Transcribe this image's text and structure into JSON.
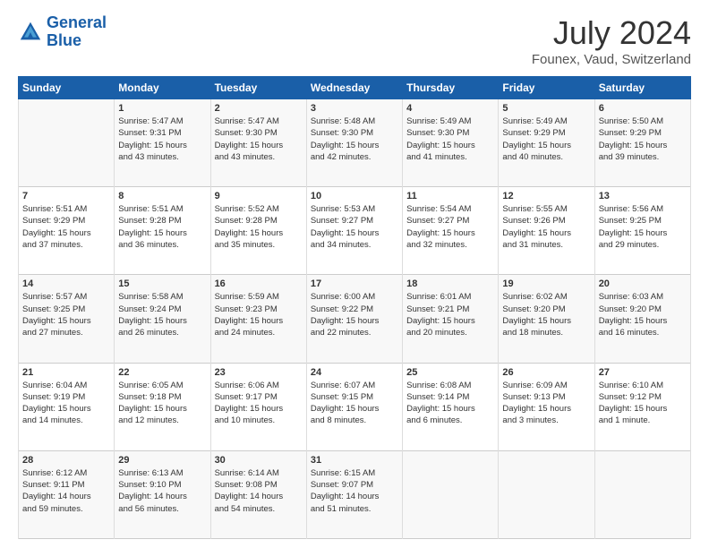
{
  "header": {
    "logo": {
      "line1": "General",
      "line2": "Blue"
    },
    "title": "July 2024",
    "location": "Founex, Vaud, Switzerland"
  },
  "weekdays": [
    "Sunday",
    "Monday",
    "Tuesday",
    "Wednesday",
    "Thursday",
    "Friday",
    "Saturday"
  ],
  "weeks": [
    [
      {
        "day": "",
        "content": ""
      },
      {
        "day": "1",
        "content": "Sunrise: 5:47 AM\nSunset: 9:31 PM\nDaylight: 15 hours\nand 43 minutes."
      },
      {
        "day": "2",
        "content": "Sunrise: 5:47 AM\nSunset: 9:30 PM\nDaylight: 15 hours\nand 43 minutes."
      },
      {
        "day": "3",
        "content": "Sunrise: 5:48 AM\nSunset: 9:30 PM\nDaylight: 15 hours\nand 42 minutes."
      },
      {
        "day": "4",
        "content": "Sunrise: 5:49 AM\nSunset: 9:30 PM\nDaylight: 15 hours\nand 41 minutes."
      },
      {
        "day": "5",
        "content": "Sunrise: 5:49 AM\nSunset: 9:29 PM\nDaylight: 15 hours\nand 40 minutes."
      },
      {
        "day": "6",
        "content": "Sunrise: 5:50 AM\nSunset: 9:29 PM\nDaylight: 15 hours\nand 39 minutes."
      }
    ],
    [
      {
        "day": "7",
        "content": "Sunrise: 5:51 AM\nSunset: 9:29 PM\nDaylight: 15 hours\nand 37 minutes."
      },
      {
        "day": "8",
        "content": "Sunrise: 5:51 AM\nSunset: 9:28 PM\nDaylight: 15 hours\nand 36 minutes."
      },
      {
        "day": "9",
        "content": "Sunrise: 5:52 AM\nSunset: 9:28 PM\nDaylight: 15 hours\nand 35 minutes."
      },
      {
        "day": "10",
        "content": "Sunrise: 5:53 AM\nSunset: 9:27 PM\nDaylight: 15 hours\nand 34 minutes."
      },
      {
        "day": "11",
        "content": "Sunrise: 5:54 AM\nSunset: 9:27 PM\nDaylight: 15 hours\nand 32 minutes."
      },
      {
        "day": "12",
        "content": "Sunrise: 5:55 AM\nSunset: 9:26 PM\nDaylight: 15 hours\nand 31 minutes."
      },
      {
        "day": "13",
        "content": "Sunrise: 5:56 AM\nSunset: 9:25 PM\nDaylight: 15 hours\nand 29 minutes."
      }
    ],
    [
      {
        "day": "14",
        "content": "Sunrise: 5:57 AM\nSunset: 9:25 PM\nDaylight: 15 hours\nand 27 minutes."
      },
      {
        "day": "15",
        "content": "Sunrise: 5:58 AM\nSunset: 9:24 PM\nDaylight: 15 hours\nand 26 minutes."
      },
      {
        "day": "16",
        "content": "Sunrise: 5:59 AM\nSunset: 9:23 PM\nDaylight: 15 hours\nand 24 minutes."
      },
      {
        "day": "17",
        "content": "Sunrise: 6:00 AM\nSunset: 9:22 PM\nDaylight: 15 hours\nand 22 minutes."
      },
      {
        "day": "18",
        "content": "Sunrise: 6:01 AM\nSunset: 9:21 PM\nDaylight: 15 hours\nand 20 minutes."
      },
      {
        "day": "19",
        "content": "Sunrise: 6:02 AM\nSunset: 9:20 PM\nDaylight: 15 hours\nand 18 minutes."
      },
      {
        "day": "20",
        "content": "Sunrise: 6:03 AM\nSunset: 9:20 PM\nDaylight: 15 hours\nand 16 minutes."
      }
    ],
    [
      {
        "day": "21",
        "content": "Sunrise: 6:04 AM\nSunset: 9:19 PM\nDaylight: 15 hours\nand 14 minutes."
      },
      {
        "day": "22",
        "content": "Sunrise: 6:05 AM\nSunset: 9:18 PM\nDaylight: 15 hours\nand 12 minutes."
      },
      {
        "day": "23",
        "content": "Sunrise: 6:06 AM\nSunset: 9:17 PM\nDaylight: 15 hours\nand 10 minutes."
      },
      {
        "day": "24",
        "content": "Sunrise: 6:07 AM\nSunset: 9:15 PM\nDaylight: 15 hours\nand 8 minutes."
      },
      {
        "day": "25",
        "content": "Sunrise: 6:08 AM\nSunset: 9:14 PM\nDaylight: 15 hours\nand 6 minutes."
      },
      {
        "day": "26",
        "content": "Sunrise: 6:09 AM\nSunset: 9:13 PM\nDaylight: 15 hours\nand 3 minutes."
      },
      {
        "day": "27",
        "content": "Sunrise: 6:10 AM\nSunset: 9:12 PM\nDaylight: 15 hours\nand 1 minute."
      }
    ],
    [
      {
        "day": "28",
        "content": "Sunrise: 6:12 AM\nSunset: 9:11 PM\nDaylight: 14 hours\nand 59 minutes."
      },
      {
        "day": "29",
        "content": "Sunrise: 6:13 AM\nSunset: 9:10 PM\nDaylight: 14 hours\nand 56 minutes."
      },
      {
        "day": "30",
        "content": "Sunrise: 6:14 AM\nSunset: 9:08 PM\nDaylight: 14 hours\nand 54 minutes."
      },
      {
        "day": "31",
        "content": "Sunrise: 6:15 AM\nSunset: 9:07 PM\nDaylight: 14 hours\nand 51 minutes."
      },
      {
        "day": "",
        "content": ""
      },
      {
        "day": "",
        "content": ""
      },
      {
        "day": "",
        "content": ""
      }
    ]
  ]
}
